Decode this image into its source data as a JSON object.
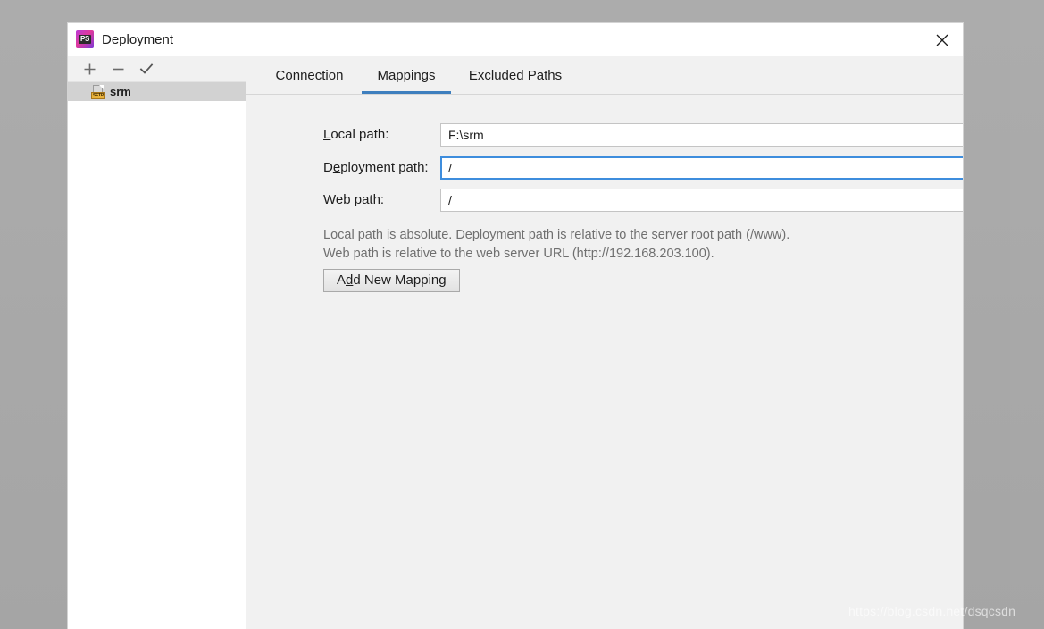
{
  "window": {
    "title": "Deployment",
    "app_icon": "phpstorm-icon",
    "app_icon_glyph": "PS",
    "close_icon": "close-icon"
  },
  "list_toolbar": {
    "add_label": "+",
    "remove_label": "−",
    "apply_label": "✓",
    "add_icon": "plus-icon",
    "remove_icon": "minus-icon",
    "apply_icon": "check-icon"
  },
  "server_list": {
    "items": [
      {
        "label": "srm",
        "icon": "sftp-icon",
        "badge": "SFTP",
        "selected": true
      }
    ]
  },
  "tabs": [
    {
      "label": "Connection",
      "active": false
    },
    {
      "label": "Mappings",
      "active": true
    },
    {
      "label": "Excluded Paths",
      "active": false
    }
  ],
  "form": {
    "local_path": {
      "label_pre": "",
      "label_mnemonic": "L",
      "label_post": "ocal path:",
      "value": "F:\\srm",
      "browse_icon": "folder-icon",
      "focused": false
    },
    "deployment_path": {
      "label_pre": "D",
      "label_mnemonic": "e",
      "label_post": "ployment path:",
      "value": "/",
      "browse_icon": "folder-icon",
      "focused": true
    },
    "web_path": {
      "label_pre": "",
      "label_mnemonic": "W",
      "label_post": "eb path:",
      "value": "/",
      "browse_icon": null,
      "focused": false
    }
  },
  "hint": {
    "line1": "Local path is absolute. Deployment path is relative to the server root path (/www).",
    "line2": "Web path is relative to the web server URL (http://192.168.203.100)."
  },
  "add_mapping_button": {
    "label_pre": "A",
    "label_mnemonic": "d",
    "label_post": "d New Mapping"
  },
  "watermark": {
    "text": "https://blog.csdn.net/dsqcsdn"
  },
  "colors": {
    "accent_tab": "#3e7fbe",
    "focus_border": "#3e8ddd",
    "dialog_bg": "#f1f1f1",
    "selection": "#d2d2d2",
    "hint_text": "#6f6f6f",
    "sftp_badge": "#e8b23c"
  }
}
